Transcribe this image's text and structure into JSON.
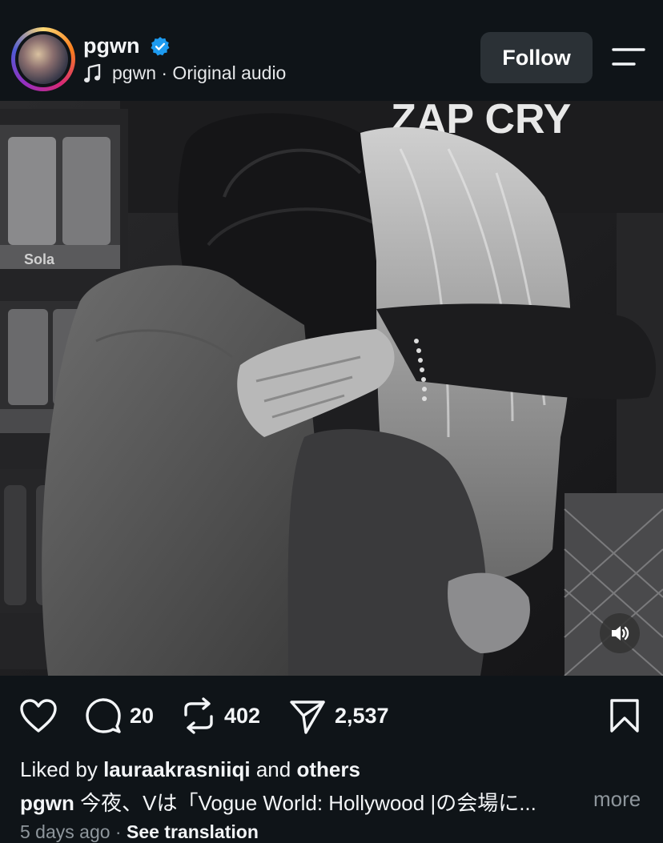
{
  "post": {
    "username": "pgwn",
    "audio_text": "pgwn · Original audio",
    "follow_label": "Follow",
    "verified_color": "#1d9bf0"
  },
  "media": {
    "background_text": "ZAP CRY",
    "shelf_label": "Sola"
  },
  "actions": {
    "comments": "20",
    "reposts": "402",
    "shares": "2,537"
  },
  "caption": {
    "liked_prefix": "Liked by ",
    "liked_user": "lauraakrasniiqi",
    "liked_middle": " and ",
    "liked_others": "others",
    "author": "pgwn",
    "text": " 今夜、Vは「Vogue World: Hollywood |の会場に...",
    "more_label": "more",
    "time": "5 days ago",
    "separator": " · ",
    "see_translation": "See translation"
  }
}
